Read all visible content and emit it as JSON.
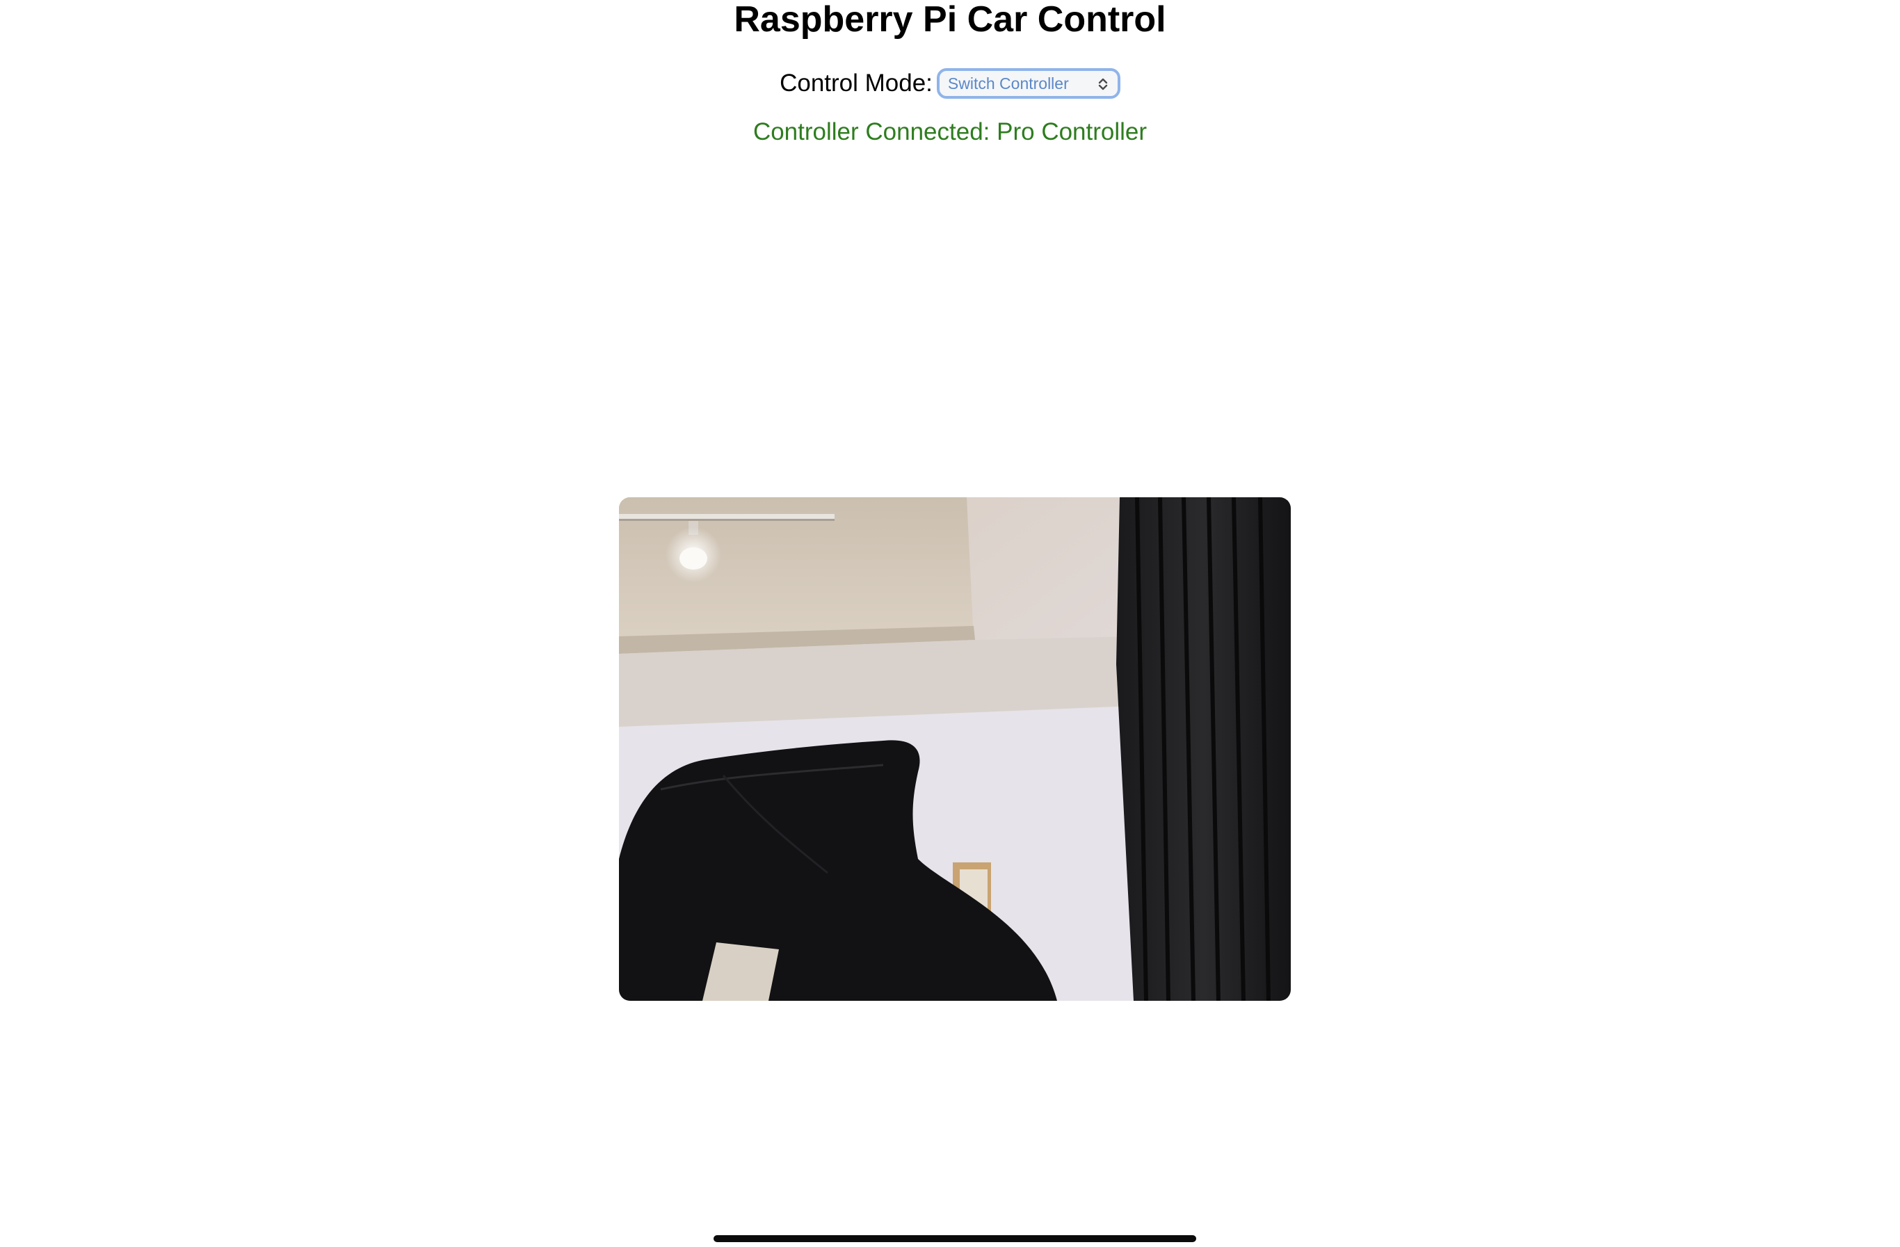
{
  "page": {
    "title": "Raspberry Pi Car Control"
  },
  "control_mode": {
    "label": "Control Mode:",
    "selected": "Switch Controller",
    "chevron_icon": "up-down-chevron-icon",
    "accent_color": "#8fb4ea"
  },
  "status": {
    "text": "Controller Connected: Pro Controller",
    "color": "#2e7d1f"
  },
  "camera_feed": {
    "icon": "camera-feed-image"
  }
}
